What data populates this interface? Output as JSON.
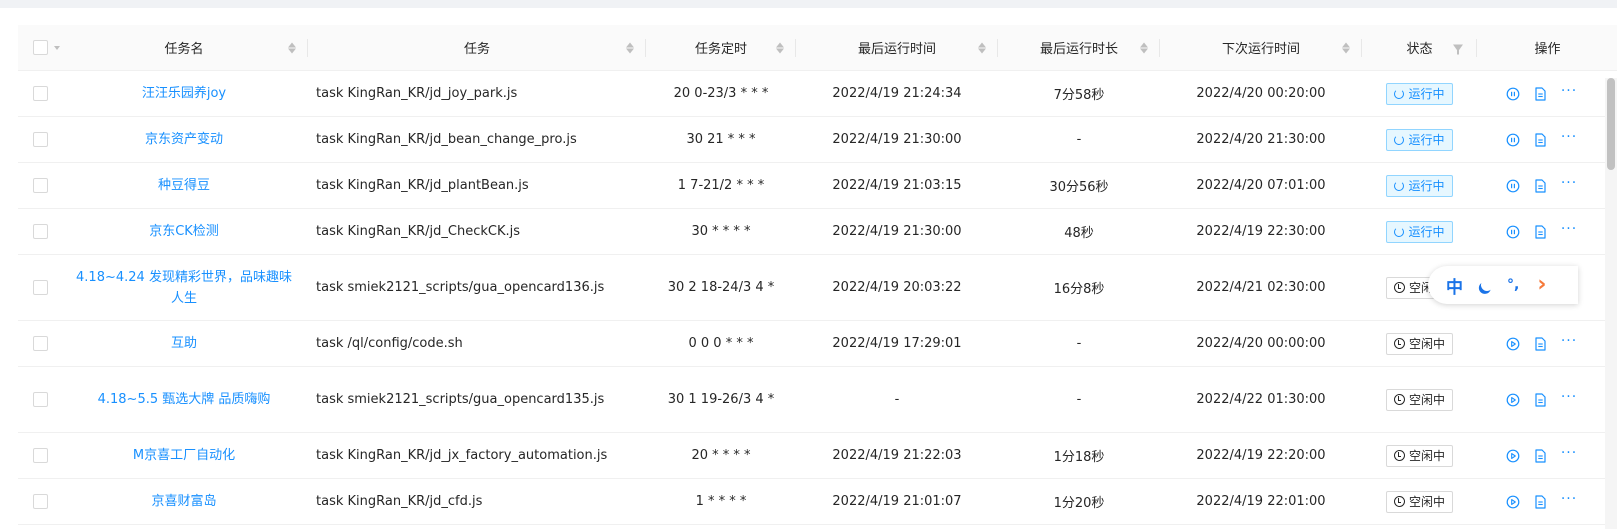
{
  "columns": {
    "name": "任务名",
    "command": "任务",
    "schedule": "任务定时",
    "last_run": "最后运行时间",
    "last_duration": "最后运行时长",
    "next_run": "下次运行时间",
    "status": "状态",
    "actions": "操作"
  },
  "rows": [
    {
      "name": "汪汪乐园养joy",
      "command": "task KingRan_KR/jd_joy_park.js",
      "schedule": "20 0-23/3 * * *",
      "last_run": "2022/4/19 21:24:34",
      "last_duration": "7分58秒",
      "next_run": "2022/4/20 00:20:00",
      "status": "运行中",
      "state": "running"
    },
    {
      "name": "京东资产变动",
      "command": "task KingRan_KR/jd_bean_change_pro.js",
      "schedule": "30 21 * * *",
      "last_run": "2022/4/19 21:30:00",
      "last_duration": "-",
      "next_run": "2022/4/20 21:30:00",
      "status": "运行中",
      "state": "running"
    },
    {
      "name": "种豆得豆",
      "command": "task KingRan_KR/jd_plantBean.js",
      "schedule": "1 7-21/2 * * *",
      "last_run": "2022/4/19 21:03:15",
      "last_duration": "30分56秒",
      "next_run": "2022/4/20 07:01:00",
      "status": "运行中",
      "state": "running"
    },
    {
      "name": "京东CK检测",
      "command": "task KingRan_KR/jd_CheckCK.js",
      "schedule": "30 * * * *",
      "last_run": "2022/4/19 21:30:00",
      "last_duration": "48秒",
      "next_run": "2022/4/19 22:30:00",
      "status": "运行中",
      "state": "running"
    },
    {
      "name": "4.18~4.24 发现精彩世界，品味趣味人生",
      "command": "task smiek2121_scripts/gua_opencard136.js",
      "schedule": "30 2 18-24/3 4 *",
      "last_run": "2022/4/19 20:03:22",
      "last_duration": "16分8秒",
      "next_run": "2022/4/21 02:30:00",
      "status": "空闲中",
      "state": "idle"
    },
    {
      "name": "互助",
      "command": "task /ql/config/code.sh",
      "schedule": "0 0 0 * * *",
      "last_run": "2022/4/19 17:29:01",
      "last_duration": "-",
      "next_run": "2022/4/20 00:00:00",
      "status": "空闲中",
      "state": "idle"
    },
    {
      "name": "4.18~5.5 甄选大牌 品质嗨购",
      "command": "task smiek2121_scripts/gua_opencard135.js",
      "schedule": "30 1 19-26/3 4 *",
      "last_run": "-",
      "last_duration": "-",
      "next_run": "2022/4/22 01:30:00",
      "status": "空闲中",
      "state": "idle"
    },
    {
      "name": "M京喜工厂自动化",
      "command": "task KingRan_KR/jd_jx_factory_automation.js",
      "schedule": "20 * * * *",
      "last_run": "2022/4/19 21:22:03",
      "last_duration": "1分18秒",
      "next_run": "2022/4/19 22:20:00",
      "status": "空闲中",
      "state": "idle"
    },
    {
      "name": "京喜财富岛",
      "command": "task KingRan_KR/jd_cfd.js",
      "schedule": "1 * * * *",
      "last_run": "2022/4/19 21:01:07",
      "last_duration": "1分20秒",
      "next_run": "2022/4/19 22:01:00",
      "status": "空闲中",
      "state": "idle"
    }
  ],
  "actions": {
    "more": "···"
  },
  "ime_toolbar": {
    "mode": "中",
    "punctuation": "°,",
    "arrow": "›"
  },
  "colors": {
    "link": "#1890ff",
    "ime_accent": "#1a73e8",
    "ime_arrow": "#f5793a"
  }
}
